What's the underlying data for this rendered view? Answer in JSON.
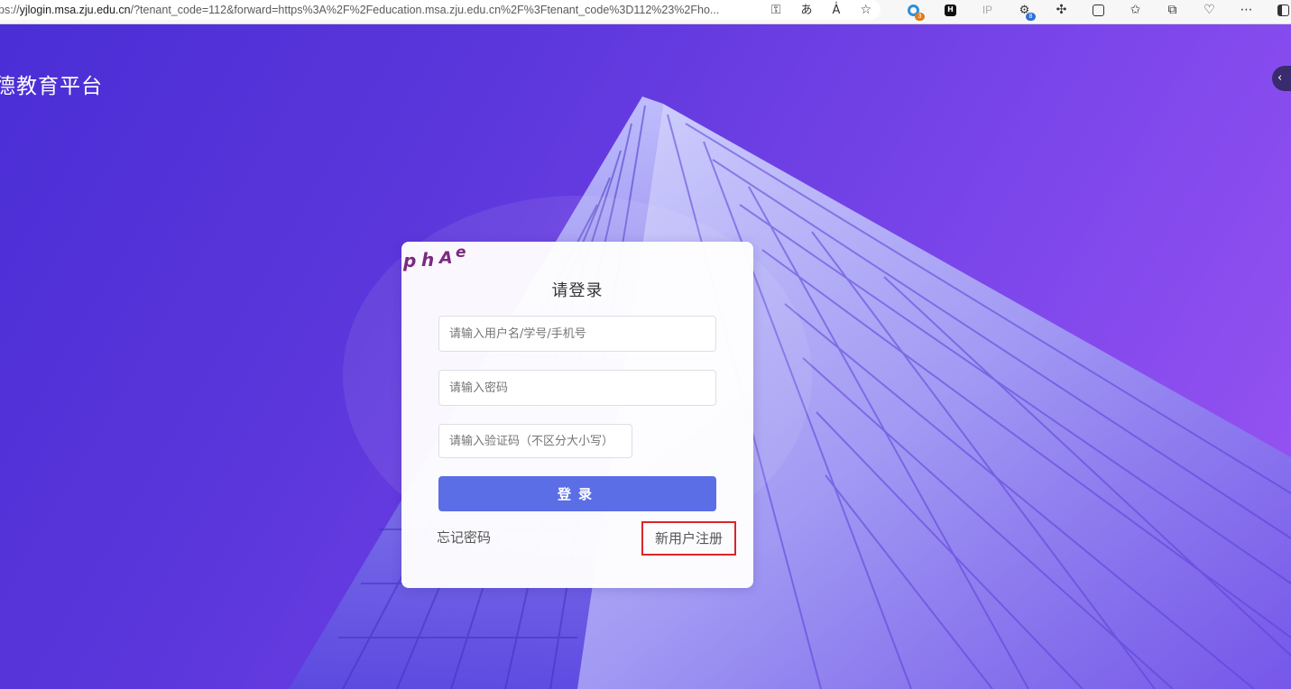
{
  "browser": {
    "url_prefix": "ps://",
    "url_host": "yjlogin.msa.zju.edu.cn",
    "url_rest": "/?tenant_code=112&forward=https%3A%2F%2Feducation.msa.zju.edu.cn%2F%3Ftenant_code%3D112%23%2Fho...",
    "toolbar": {
      "ip_label": "IP",
      "ext_badge_1": "3",
      "ext_badge_2": "8",
      "h_label": "H"
    }
  },
  "page": {
    "site_title": "德教育平台",
    "side_toggle": "‹"
  },
  "login": {
    "title": "请登录",
    "username_placeholder": "请输入用户名/学号/手机号",
    "password_placeholder": "请输入密码",
    "captcha_placeholder": "请输入验证码（不区分大小写）",
    "captcha_text": "phAe",
    "submit_label": "登录",
    "forgot_label": "忘记密码",
    "register_label": "新用户注册"
  },
  "colors": {
    "accent_button": "#5b6ee6",
    "highlight_border": "#d9262c",
    "captcha_color": "#7b2a82"
  }
}
